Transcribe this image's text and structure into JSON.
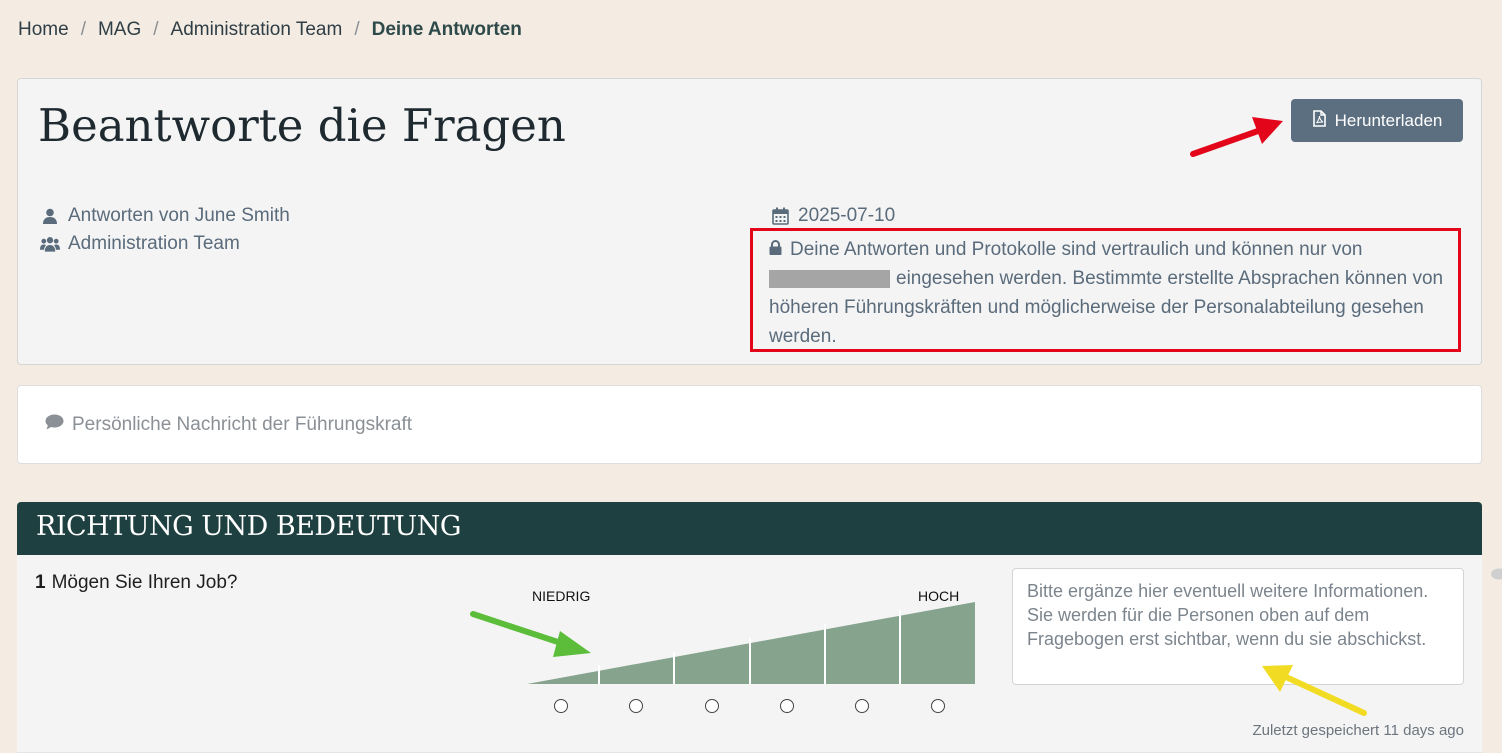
{
  "breadcrumb": {
    "items": [
      "Home",
      "MAG",
      "Administration Team"
    ],
    "current": "Deine Antworten",
    "separator": "/"
  },
  "header": {
    "title": "Beantworte die Fragen",
    "download_label": "Herunterladen",
    "download_icon": "pdf-file-icon",
    "answers_by": "Antworten von June Smith",
    "team": "Administration Team",
    "date": "2025-07-10",
    "privacy_line1": "Deine Antworten und Protokolle sind vertraulich und können nur von",
    "privacy_rest": "eingesehen werden. Bestimmte erstellte Absprachen können von höheren Führungskräften und möglicherweise der Personalabteilung gesehen werden."
  },
  "message": {
    "label": "Persönliche Nachricht der Führungskraft",
    "icon": "speech-bubble-icon"
  },
  "section": {
    "title": "RICHTUNG UND BEDEUTUNG",
    "questions": [
      {
        "number": "1",
        "text": "Mögen Sie Ihren Job?",
        "scale_low": "NIEDRIG",
        "scale_high": "HOCH",
        "scale_steps": 6,
        "placeholder": "Bitte ergänze hier eventuell weitere Informationen. Sie werden für die Personen oben auf dem Fragebogen erst sichtbar, wenn du sie abschickst.",
        "saved_status": "Zuletzt gespeichert 11 days ago"
      }
    ]
  },
  "colors": {
    "background": "#f4ece2",
    "section_header": "#1f4040",
    "download_button": "#5c6f80",
    "scale_fill": "#86a38e",
    "annotation_red": "#e3061a",
    "annotation_green": "#5cbd3a",
    "annotation_yellow": "#f2dc23"
  }
}
